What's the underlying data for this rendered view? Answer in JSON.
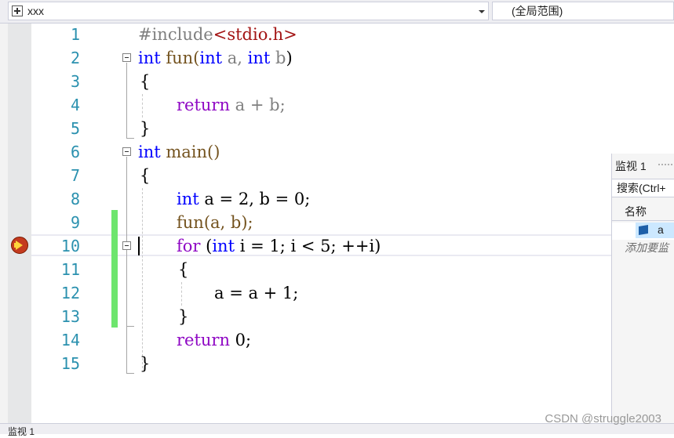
{
  "navbar": {
    "project": "xxx",
    "scope": "(全局范围)"
  },
  "editor": {
    "lines": [
      {
        "num": "1"
      },
      {
        "num": "2"
      },
      {
        "num": "3"
      },
      {
        "num": "4"
      },
      {
        "num": "5"
      },
      {
        "num": "6"
      },
      {
        "num": "7"
      },
      {
        "num": "8"
      },
      {
        "num": "9"
      },
      {
        "num": "10"
      },
      {
        "num": "11"
      },
      {
        "num": "12"
      },
      {
        "num": "13"
      },
      {
        "num": "14"
      },
      {
        "num": "15"
      }
    ],
    "current_line": "10",
    "code": {
      "l1_a": "#include",
      "l1_b": "<stdio.h>",
      "l2_int": "int",
      "l2_fn": " fun(",
      "l2_int2": "int",
      "l2_a": " a,",
      "l2_sp": " ",
      "l2_int3": "int",
      "l2_b": " b",
      "l2_close": ")",
      "l3": "{",
      "l4_ret": "return",
      "l4_rest": " a + b;",
      "l5": "}",
      "l6_int": "int",
      "l6_rest": " main()",
      "l7": "{",
      "l8_int": "int",
      "l8_rest": " a = 2, b = 0;",
      "l9": "fun(a, b);",
      "l10_for": "for",
      "l10_a": " (",
      "l10_int": "int",
      "l10_rest": " i = 1; i < 5; ++i)",
      "l11": "{",
      "l12": "a = a + 1;",
      "l13": "}",
      "l14_ret": "return",
      "l14_rest": " 0;",
      "l15": "}"
    }
  },
  "watch": {
    "title": "监视 1",
    "search_placeholder": "搜索(Ctrl+",
    "col_name": "名称",
    "var_name": "a",
    "add_hint": "添加要监"
  },
  "bottom": {
    "tab": "监视 1"
  },
  "watermark": "CSDN @struggle2003",
  "colors": {
    "keyword": "#0000ff",
    "control_keyword": "#8f08c4",
    "line_number": "#2b91af",
    "change_bar": "#6ee56e"
  }
}
